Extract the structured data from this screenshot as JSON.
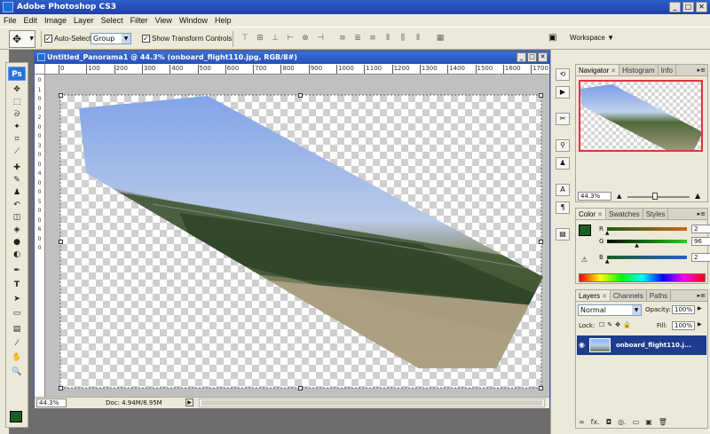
{
  "app": {
    "title": "Adobe Photoshop CS3"
  },
  "window_buttons": {
    "minimize": "_",
    "maximize": "□",
    "close": "✕"
  },
  "menu": [
    "File",
    "Edit",
    "Image",
    "Layer",
    "Select",
    "Filter",
    "View",
    "Window",
    "Help"
  ],
  "options": {
    "auto_select_label": "Auto-Select:",
    "auto_select_checked": true,
    "auto_select_value": "Group",
    "show_transform_label": "Show Transform Controls",
    "show_transform_checked": true,
    "workspace_label": "Workspace"
  },
  "document": {
    "title": "Untitled_Panorama1 @ 44.3% (onboard_flight110.jpg, RGB/8#)",
    "ruler_ticks": [
      "0",
      "100",
      "200",
      "300",
      "400",
      "500",
      "600",
      "700",
      "800",
      "900",
      "1000",
      "1100",
      "1200",
      "1300",
      "1400",
      "1500",
      "1600",
      "1700"
    ],
    "vruler_ticks": [
      "0",
      "1",
      "0",
      "0",
      "2",
      "0",
      "0",
      "3",
      "0",
      "0",
      "4",
      "0",
      "0",
      "5",
      "0",
      "0",
      "6",
      "0",
      "0"
    ],
    "status_zoom": "44.3%",
    "status_doc": "Doc: 4.94M/8.95M"
  },
  "navigator": {
    "tabs": [
      "Navigator",
      "Histogram",
      "Info"
    ],
    "zoom": "44.3%",
    "zoom_slider_fraction": 0.443
  },
  "color_panel": {
    "tabs": [
      "Color",
      "Swatches",
      "Styles"
    ],
    "foreground": "#1a5e20",
    "channels": [
      {
        "label": "R",
        "value": "2",
        "gradient": [
          "#1a5e20",
          "#c96a17"
        ],
        "fraction": 0.01
      },
      {
        "label": "G",
        "value": "96",
        "gradient": [
          "#0b0b0b",
          "#22cc22"
        ],
        "fraction": 0.38
      },
      {
        "label": "B",
        "value": "2",
        "gradient": [
          "#1a5e20",
          "#2a5ed6"
        ],
        "fraction": 0.01
      }
    ]
  },
  "layers_panel": {
    "tabs": [
      "Layers",
      "Channels",
      "Paths"
    ],
    "blend_mode": "Normal",
    "opacity_label": "Opacity:",
    "opacity_value": "100%",
    "lock_label": "Lock:",
    "fill_label": "Fill:",
    "fill_value": "100%",
    "layers": [
      {
        "name": "onboard_flight110.j..."
      }
    ],
    "bottom_icons": [
      "∞",
      "fx.",
      "◘",
      "◎.",
      "▭",
      "▣",
      "🗑"
    ]
  },
  "colors": {
    "titlebar": "#1d3fa3",
    "selection": "#1d3c8e",
    "nav_frame": "#d9363e",
    "foreground_swatch": "#1a5e20"
  }
}
